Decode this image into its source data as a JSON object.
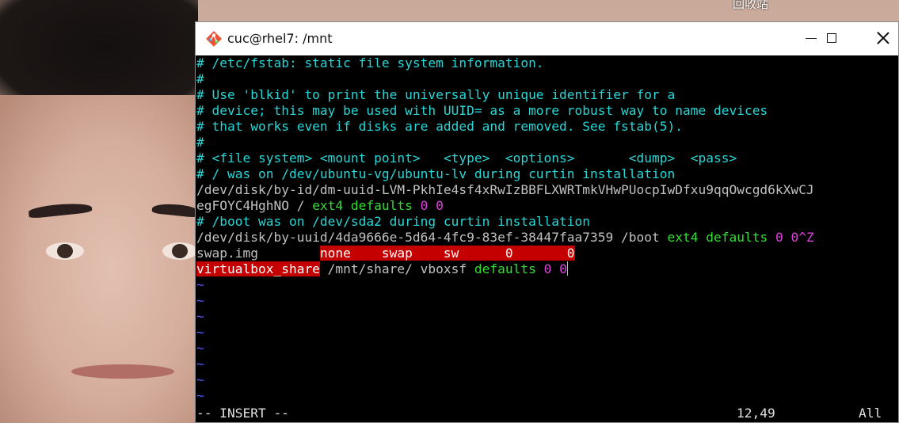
{
  "desktop": {
    "recycle_bin_label": "回收站"
  },
  "window": {
    "title": "cuc@rhel7: /mnt",
    "app_icon": "git-bash-icon",
    "controls": [
      "minimize-icon",
      "maximize-icon",
      "close-icon"
    ]
  },
  "editor": {
    "lines": [
      {
        "text": "# /etc/fstab: static file system information.",
        "kind": "comment"
      },
      {
        "text": "#",
        "kind": "comment"
      },
      {
        "text": "# Use 'blkid' to print the universally unique identifier for a",
        "kind": "comment"
      },
      {
        "text": "# device; this may be used with UUID= as a more robust way to name devices",
        "kind": "comment"
      },
      {
        "text": "# that works even if disks are added and removed. See fstab(5).",
        "kind": "comment"
      },
      {
        "text": "#",
        "kind": "comment"
      },
      {
        "text": "# <file system> <mount point>   <type>  <options>       <dump>  <pass>",
        "kind": "comment"
      },
      {
        "text": "# / was on /dev/ubuntu-vg/ubuntu-lv during curtin installation",
        "kind": "comment"
      },
      {
        "text": "/dev/disk/by-id/dm-uuid-LVM-PkhIe4sf4xRwIzBBFLXWRTmkVHwPUocpIwDfxu9qqOwcgd6kXwCJ",
        "kind": "plain"
      },
      {
        "segments": [
          "egFOYC4HghNO / ",
          "ext4 defaults",
          " ",
          "0 0"
        ]
      },
      {
        "text": "# /boot was on /dev/sda2 during curtin installation",
        "kind": "comment"
      },
      {
        "segments": [
          "/dev/disk/by-uuid/4da9666e-5d64-4fc9-83ef-38447faa7359 /boot ",
          "ext4 defaults",
          " ",
          "0 0",
          "^Z"
        ]
      },
      {
        "segments": [
          "swap.img        ",
          "none    swap    sw      0       0"
        ]
      },
      {
        "segments": [
          "virtualbox_share",
          " /mnt/share/ vboxsf ",
          "defaults",
          " ",
          "0 0"
        ]
      }
    ],
    "tilde": "~",
    "mode": "-- INSERT --",
    "cursor_position": "12,49",
    "scroll": "All"
  }
}
